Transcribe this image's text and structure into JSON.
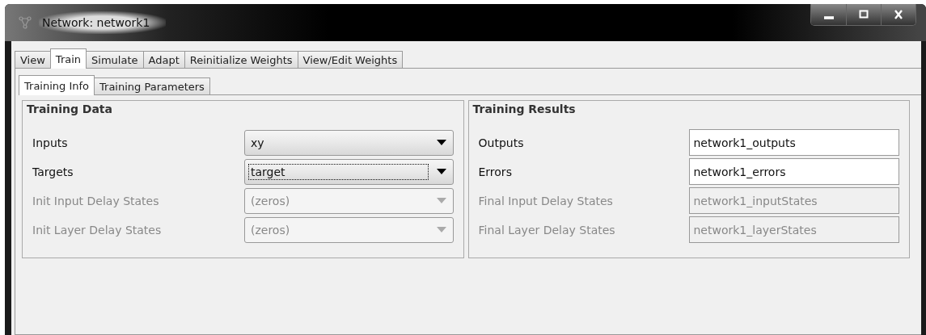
{
  "window": {
    "title": "Network: network1"
  },
  "tabs": [
    {
      "label": "View",
      "selected": false
    },
    {
      "label": "Train",
      "selected": true
    },
    {
      "label": "Simulate",
      "selected": false
    },
    {
      "label": "Adapt",
      "selected": false
    },
    {
      "label": "Reinitialize Weights",
      "selected": false
    },
    {
      "label": "View/Edit Weights",
      "selected": false
    }
  ],
  "subtabs": [
    {
      "label": "Training Info",
      "selected": true
    },
    {
      "label": "Training Parameters",
      "selected": false
    }
  ],
  "training_data": {
    "title": "Training Data",
    "rows": [
      {
        "label": "Inputs",
        "value": "xy",
        "disabled": false,
        "focused": false
      },
      {
        "label": "Targets",
        "value": "target",
        "disabled": false,
        "focused": true
      },
      {
        "label": "Init Input Delay States",
        "value": "(zeros)",
        "disabled": true,
        "focused": false
      },
      {
        "label": "Init Layer Delay States",
        "value": "(zeros)",
        "disabled": true,
        "focused": false
      }
    ]
  },
  "training_results": {
    "title": "Training Results",
    "rows": [
      {
        "label": "Outputs",
        "value": "network1_outputs",
        "disabled": false
      },
      {
        "label": "Errors",
        "value": "network1_errors",
        "disabled": false
      },
      {
        "label": "Final Input Delay States",
        "value": "network1_inputStates",
        "disabled": true
      },
      {
        "label": "Final Layer Delay States",
        "value": "network1_layerStates",
        "disabled": true
      }
    ]
  }
}
